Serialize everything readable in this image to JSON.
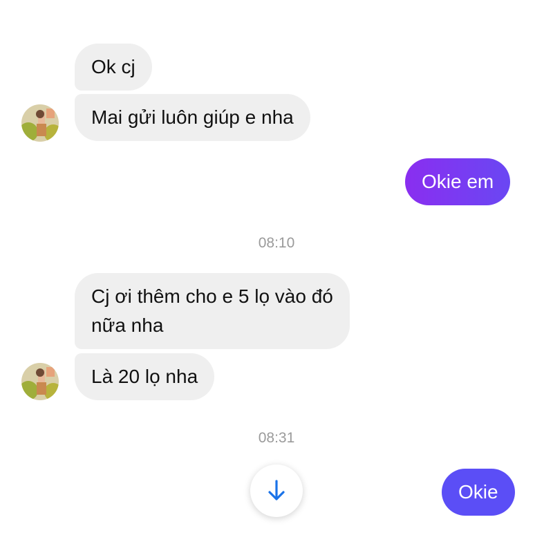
{
  "theme": {
    "incoming_bubble": "#efefef",
    "outgoing_gradient_start": "#8a2ef0",
    "outgoing_gradient_end": "#5a4ff5",
    "outgoing_solid": "#5b4ef6",
    "timestamp_color": "#9a9a9a",
    "scroll_arrow_color": "#1a73e8"
  },
  "messages": {
    "m1": "Ok cj",
    "m2": "Mai gửi luôn giúp e nha",
    "m3": "Okie em",
    "m4_line1": "Cj ơi thêm cho e 5 lọ vào đó",
    "m4_line2": "nữa nha",
    "m5": "Là 20 lọ nha",
    "m6": "Okie"
  },
  "timestamps": {
    "t1": "08:10",
    "t2": "08:31"
  },
  "icons": {
    "scroll": "arrow-down-icon",
    "avatar": "contact-avatar"
  }
}
